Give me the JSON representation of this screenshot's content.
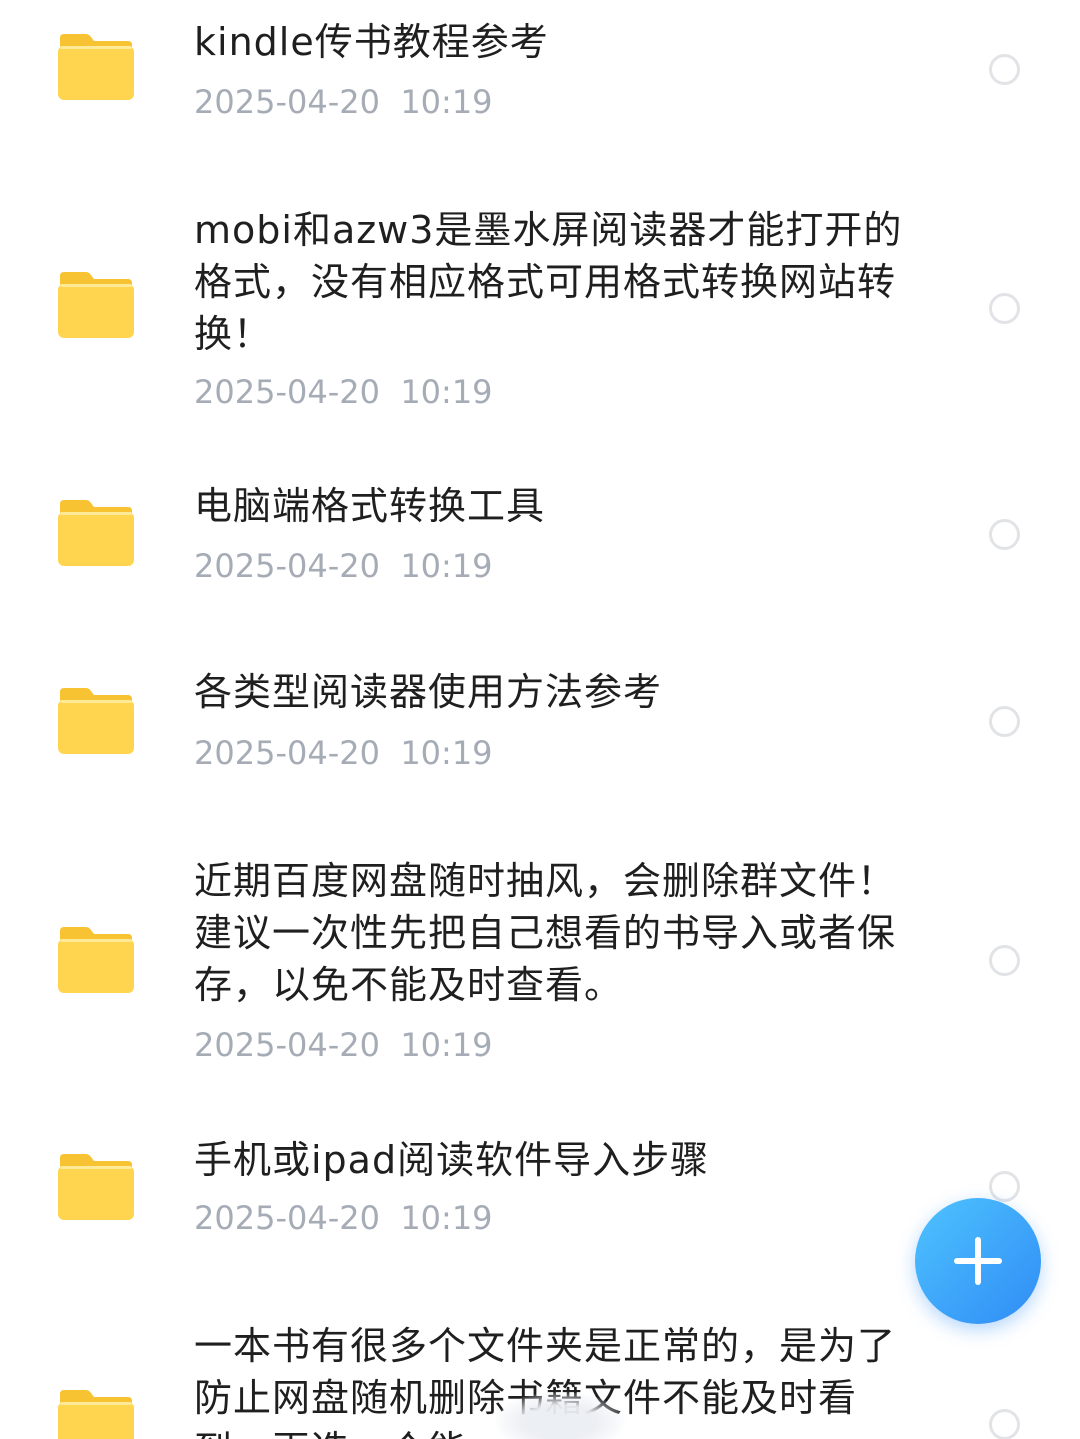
{
  "colors": {
    "folder": "#ffd54f",
    "folder_tab": "#f7c333",
    "fab": "#2f8cf5",
    "time": "#a6acb6"
  },
  "items": [
    {
      "lines": [
        "kindle传书教程参考"
      ],
      "time": "2025-04-20  10:19"
    },
    {
      "lines": [
        "mobi和azw3是墨水屏阅读器才能打开的",
        "格式，没有相应格式可用格式转换网站转",
        "换！"
      ],
      "time": "2025-04-20  10:19"
    },
    {
      "lines": [
        "电脑端格式转换工具"
      ],
      "time": "2025-04-20  10:19"
    },
    {
      "lines": [
        "各类型阅读器使用方法参考"
      ],
      "time": "2025-04-20  10:19"
    },
    {
      "lines": [
        "近期百度网盘随时抽风，会删除群文件！",
        "建议一次性先把自己想看的书导入或者保",
        "存，以免不能及时查看。"
      ],
      "time": "2025-04-20  10:19"
    },
    {
      "lines": [
        "手机或ipad阅读软件导入步骤"
      ],
      "time": "2025-04-20  10:19"
    },
    {
      "lines": [
        "一本书有很多个文件夹是正常的，是为了",
        "防止网盘随机删除书籍文件不能及时看",
        "到，再选一个能"
      ],
      "time": ""
    }
  ],
  "fab": {
    "icon": "plus-icon"
  },
  "icons": {
    "folder": "folder-icon",
    "select": "radio-circle-icon"
  }
}
